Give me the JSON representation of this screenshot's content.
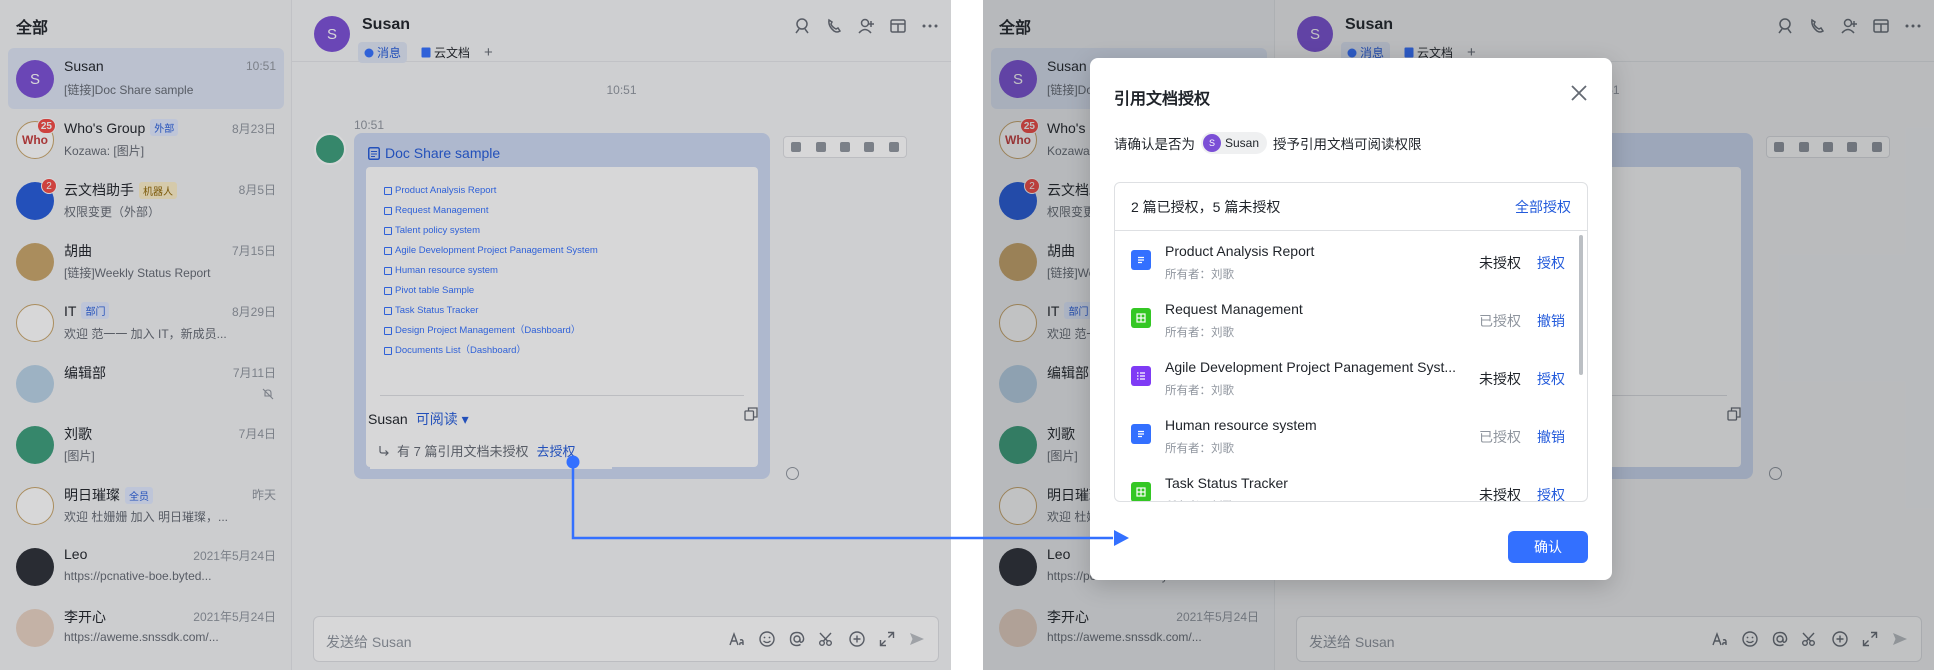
{
  "sidebar": {
    "title": "全部",
    "conversations": [
      {
        "name": "Susan",
        "time": "10:51",
        "preview": "[链接]Doc Share sample",
        "avatar_text": "S",
        "avatar_color": "#7b4fd6",
        "active": true
      },
      {
        "name": "Who's Group",
        "tag": "外部",
        "time": "8月23日",
        "preview": "Kozawa: [图片]",
        "avatar_text": "Who",
        "avatar_color": "#ffffff",
        "badge": "25"
      },
      {
        "name": "云文档助手",
        "tag": "机器人",
        "time": "8月5日",
        "preview": "权限变更（外部）",
        "avatar_text": "",
        "avatar_color": "#245bdb",
        "badge": "2"
      },
      {
        "name": "胡曲",
        "time": "7月15日",
        "preview": "[链接]Weekly Status Report",
        "avatar_text": "",
        "avatar_color": "#c9a56a"
      },
      {
        "name": "IT",
        "tag": "部门",
        "time": "8月29日",
        "preview": "欢迎 范一一 加入 IT，新成员...",
        "avatar_text": "",
        "avatar_color": "#ffffff"
      },
      {
        "name": "编辑部",
        "time": "7月11日",
        "preview": "",
        "avatar_text": "",
        "avatar_color": "#b9d2e6"
      },
      {
        "name": "刘歌",
        "time": "7月4日",
        "preview": "[图片]",
        "avatar_text": "",
        "avatar_color": "#3b9e7a"
      },
      {
        "name": "明日璀璨",
        "tag": "全员",
        "time": "昨天",
        "preview": "欢迎 杜姗姗 加入 明日璀璨，...",
        "avatar_text": "",
        "avatar_color": "#ffffff"
      },
      {
        "name": "Leo",
        "time": "2021年5月24日",
        "preview": "https://pcnative-boe.byted...",
        "avatar_text": "",
        "avatar_color": "#2b2f36"
      },
      {
        "name": "李开心",
        "time": "2021年5月24日",
        "preview": "https://aweme.snssdk.com/...",
        "avatar_text": "",
        "avatar_color": "#e8d2c2"
      }
    ]
  },
  "chat": {
    "title": "Susan",
    "avatar_text": "S",
    "tabs": [
      {
        "label": "消息"
      },
      {
        "label": "云文档"
      }
    ],
    "tab_plus": "+",
    "time_divider": "10:51",
    "msg_time": "10:51",
    "card": {
      "title": "Doc Share sample",
      "doc_lines": [
        "Product Analysis Report",
        "Request Management",
        "Talent policy system",
        "Agile Development Project Panagement System",
        "Human resource system",
        "Pivot table Sample",
        "Task Status Tracker",
        "Design Project Management（Dashboard）",
        "Documents List（Dashboard）"
      ],
      "owner": "Susan",
      "permission": "可阅读",
      "unauth_text": "有 7 篇引用文档未授权",
      "unauth_link": "去授权"
    },
    "input_placeholder": "发送给 Susan"
  },
  "modal": {
    "title": "引用文档授权",
    "desc_prefix": "请确认是否为",
    "user_chip": "Susan",
    "user_chip_initial": "S",
    "desc_suffix": "授予引用文档可阅读权限",
    "summary": "2 篇已授权，5 篇未授权",
    "grant_all": "全部授权",
    "rows": [
      {
        "name": "Product Analysis Report",
        "owner": "所有者：刘歌",
        "status": "未授权",
        "action": "授权",
        "type": "docx",
        "granted": false
      },
      {
        "name": "Request Management",
        "owner": "所有者：刘歌",
        "status": "已授权",
        "action": "撤销",
        "type": "sheet",
        "granted": true
      },
      {
        "name": "Agile Development Project Panagement Syst...",
        "owner": "所有者：刘歌",
        "status": "未授权",
        "action": "授权",
        "type": "bitable",
        "granted": false
      },
      {
        "name": "Human resource system",
        "owner": "所有者：刘歌",
        "status": "已授权",
        "action": "撤销",
        "type": "docx",
        "granted": true
      },
      {
        "name": "Task Status Tracker",
        "owner": "所有者：刘歌",
        "status": "未授权",
        "action": "授权",
        "type": "sheet",
        "granted": false
      }
    ],
    "confirm": "确认"
  },
  "colors": {
    "accent": "#3370ff",
    "link": "#245bdb"
  }
}
